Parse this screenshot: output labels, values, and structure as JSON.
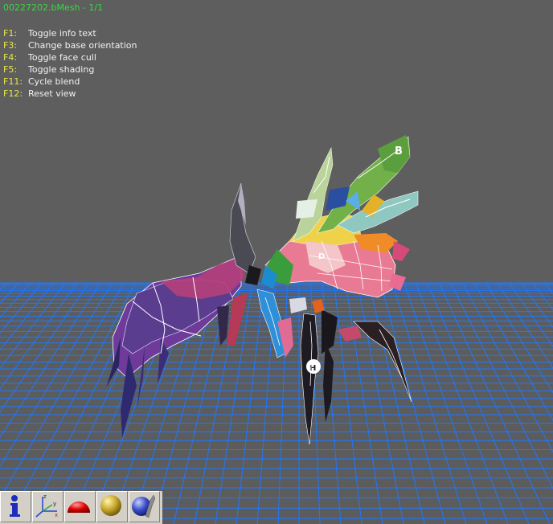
{
  "window": {
    "title": "00227202.bMesh - 1/1"
  },
  "help": [
    {
      "key": "F1:",
      "action": "Toggle info text"
    },
    {
      "key": "F3:",
      "action": "Change base orientation"
    },
    {
      "key": "F4:",
      "action": "Toggle face cull"
    },
    {
      "key": "F5:",
      "action": "Toggle shading"
    },
    {
      "key": "F11:",
      "action": "Cycle blend"
    },
    {
      "key": "F12:",
      "action": "Reset view"
    }
  ],
  "toolbar": {
    "buttons": [
      {
        "name": "info-icon"
      },
      {
        "name": "axes-icon"
      },
      {
        "name": "dome-icon"
      },
      {
        "name": "sphere-icon"
      },
      {
        "name": "shaded-sphere-icon"
      }
    ]
  },
  "colors": {
    "background": "#5e5e5e",
    "grid": "#1e78ff",
    "title": "#39d646",
    "help_key": "#e9e64a",
    "help_text": "#f2f2f2"
  }
}
